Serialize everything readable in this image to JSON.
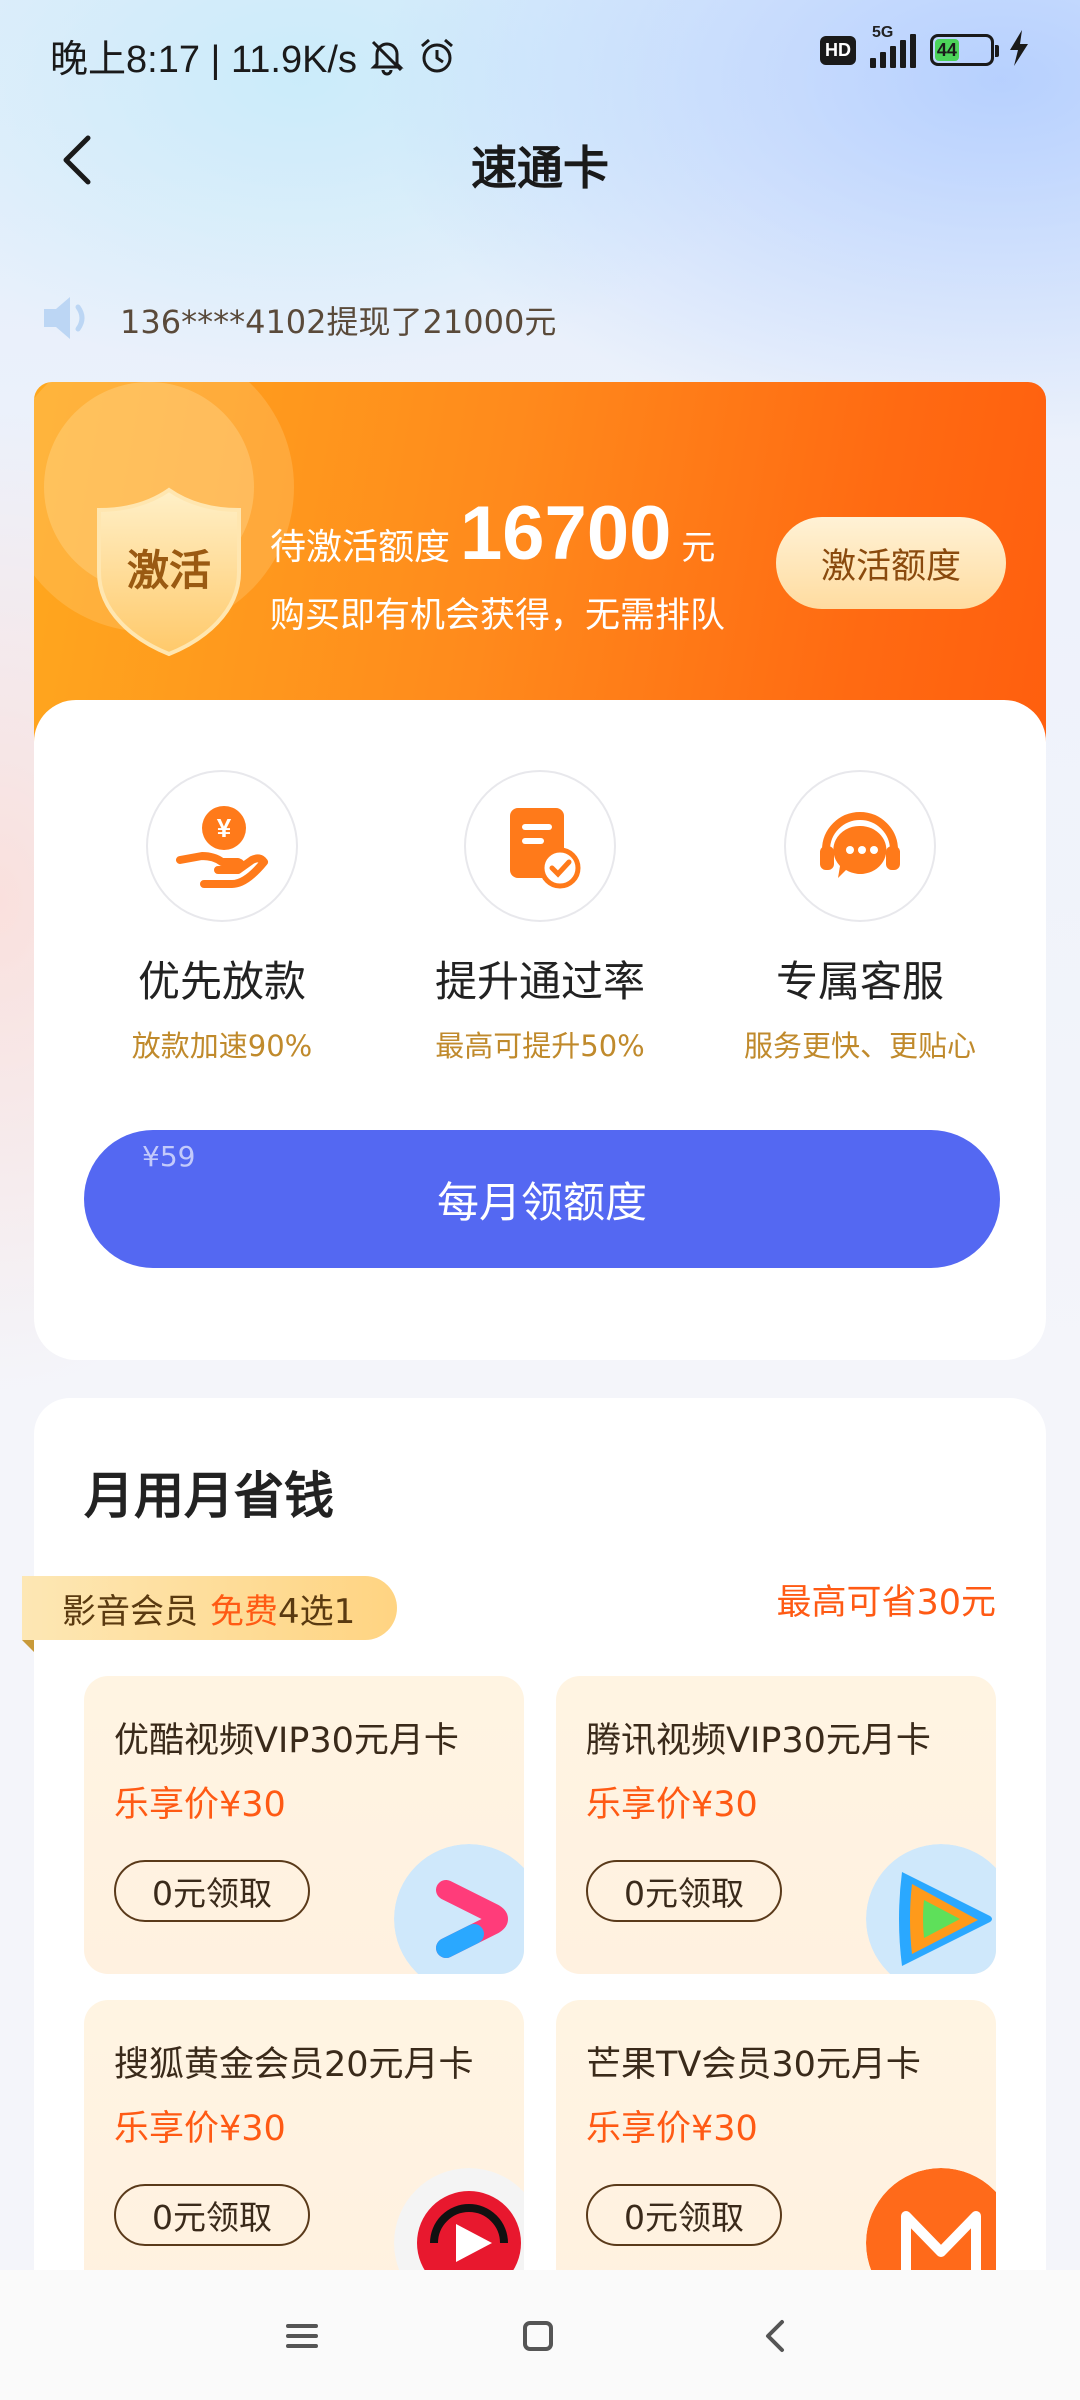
{
  "status_bar": {
    "time_speed": "晚上8:17 | 11.9K/s",
    "hd": "HD",
    "network": "5G",
    "battery": "44",
    "icons": [
      "mute-bell-icon",
      "alarm-icon",
      "hd-icon",
      "signal-icon",
      "battery-icon",
      "charging-icon"
    ]
  },
  "header": {
    "title": "速通卡",
    "back_icon": "chevron-left-icon"
  },
  "notice": {
    "icon": "speaker-icon",
    "text": "136****4102提现了21000元"
  },
  "activate": {
    "badge": "激活",
    "pending_label": "待激活额度",
    "amount": "16700",
    "unit": "元",
    "subtitle": "购买即有机会获得，无需排队",
    "button": "激活额度"
  },
  "benefits": [
    {
      "icon": "yen-hand-icon",
      "title": "优先放款",
      "subtitle": "放款加速90%"
    },
    {
      "icon": "document-check-icon",
      "title": "提升通过率",
      "subtitle": "最高可提升50%"
    },
    {
      "icon": "customer-service-icon",
      "title": "专属客服",
      "subtitle": "服务更快、更贴心"
    }
  ],
  "monthly": {
    "price": "¥59",
    "button": "每月领额度"
  },
  "savings": {
    "title": "月用月省钱",
    "tag_prefix": "影音会员",
    "tag_free": "免费",
    "tag_pick": "4选1",
    "max_save": "最高可省30元",
    "offers": [
      {
        "name": "优酷视频VIP30元月卡",
        "price": "乐享价¥30",
        "button": "0元领取",
        "logo": "youku-logo"
      },
      {
        "name": "腾讯视频VIP30元月卡",
        "price": "乐享价¥30",
        "button": "0元领取",
        "logo": "tencent-video-logo"
      },
      {
        "name": "搜狐黄金会员20元月卡",
        "price": "乐享价¥30",
        "button": "0元领取",
        "logo": "sohu-video-logo"
      },
      {
        "name": "芒果TV会员30元月卡",
        "price": "乐享价¥30",
        "button": "0元领取",
        "logo": "mango-tv-logo"
      }
    ]
  },
  "nav": {
    "icons": [
      "menu-icon",
      "home-icon",
      "back-icon"
    ]
  },
  "colors": {
    "orange_start": "#ffa81e",
    "orange_end": "#ff5e0e",
    "accent_blue": "#5468f2",
    "price_orange": "#ff5a14",
    "gold_text": "#c08a2c"
  }
}
